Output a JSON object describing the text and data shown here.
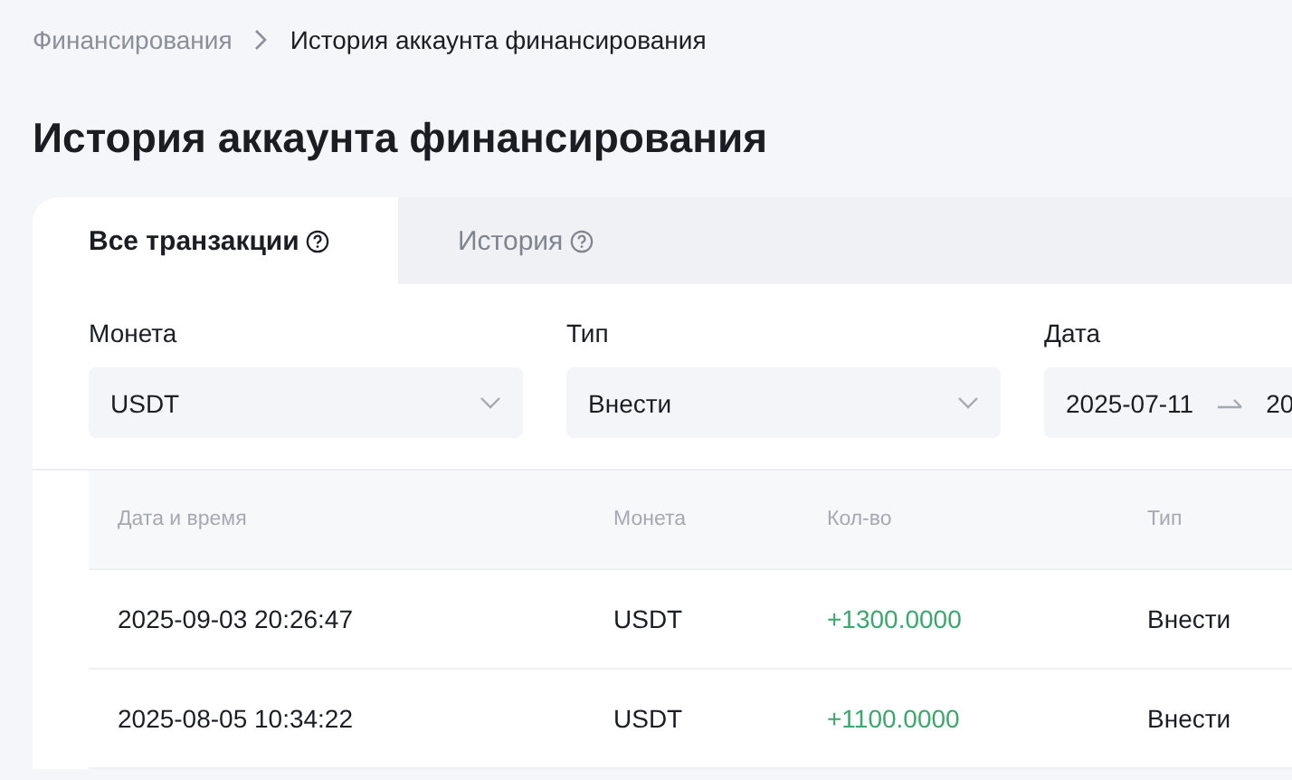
{
  "breadcrumb": [
    {
      "label": "Финансирования",
      "current": false
    },
    {
      "label": "История аккаунта финансирования",
      "current": true
    }
  ],
  "title": "История аккаунта финансирования",
  "tabs": [
    {
      "label": "Все транзакции",
      "selected": true
    },
    {
      "label": "История",
      "selected": false
    }
  ],
  "filters": [
    {
      "kind": "select",
      "label": "Монета",
      "value": "USDT"
    },
    {
      "kind": "select",
      "label": "Тип",
      "value": "Внести"
    },
    {
      "kind": "daterange",
      "label": "Дата",
      "start": "2025-07-11",
      "end": "20"
    }
  ],
  "table": {
    "columns": [
      "Дата и время",
      "Монета",
      "Кол-во",
      "Тип"
    ],
    "rows": [
      {
        "cells": [
          "2025-09-03 20:26:47",
          "USDT",
          "+1300.0000",
          "Внести"
        ]
      },
      {
        "cells": [
          "2025-08-05 10:34:22",
          "USDT",
          "+1100.0000",
          "Внести"
        ]
      }
    ]
  }
}
